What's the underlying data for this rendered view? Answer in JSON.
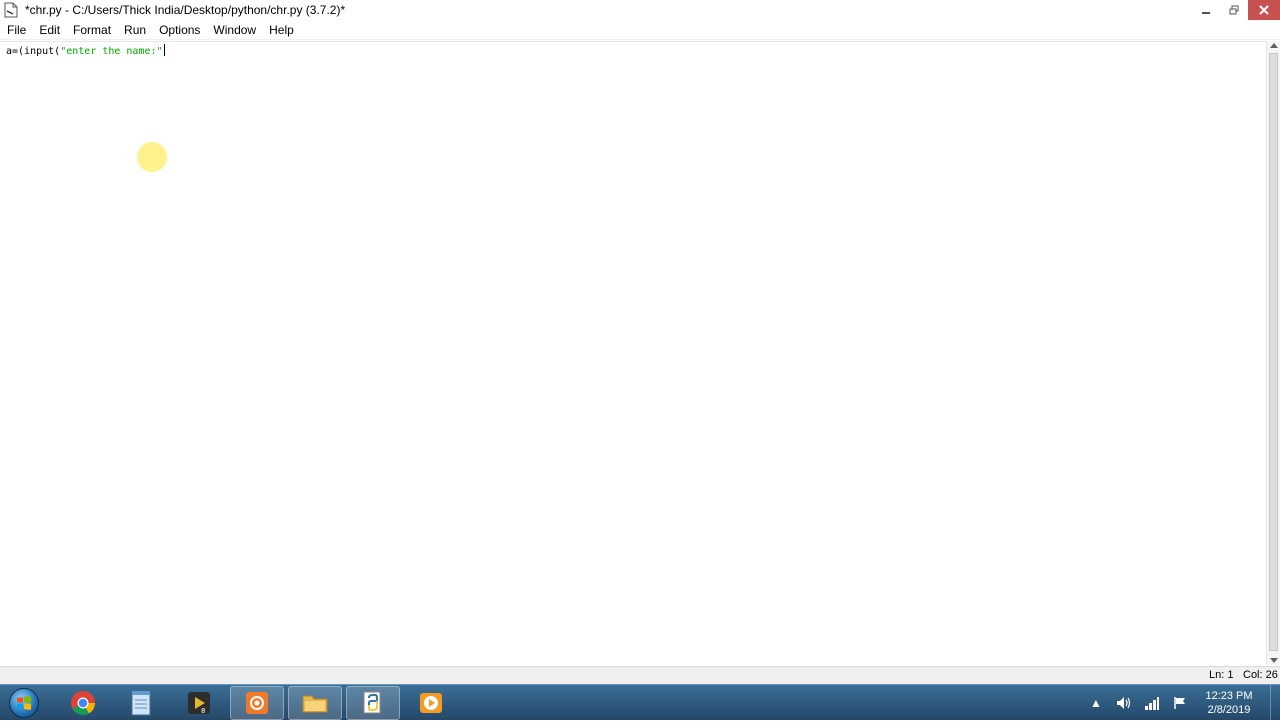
{
  "window": {
    "title": "*chr.py - C:/Users/Thick India/Desktop/python/chr.py (3.7.2)*"
  },
  "menu": {
    "items": [
      "File",
      "Edit",
      "Format",
      "Run",
      "Options",
      "Window",
      "Help"
    ]
  },
  "editor": {
    "code_prefix": "a=(input(",
    "code_string": "\"enter the name:\""
  },
  "status": {
    "line": "Ln: 1",
    "col": "Col: 26"
  },
  "taskbar": {
    "apps": [
      "start-orb-icon",
      "chrome-icon",
      "notepad-icon",
      "camtasia-icon",
      "screen-recorder-icon",
      "explorer-icon",
      "python-idle-icon",
      "media-player-icon"
    ],
    "clock_time": "12:23 PM",
    "clock_date": "2/8/2019"
  },
  "colors": {
    "string": "#00aa00",
    "close_button": "#c75050",
    "taskbar": "#2f5b80"
  }
}
